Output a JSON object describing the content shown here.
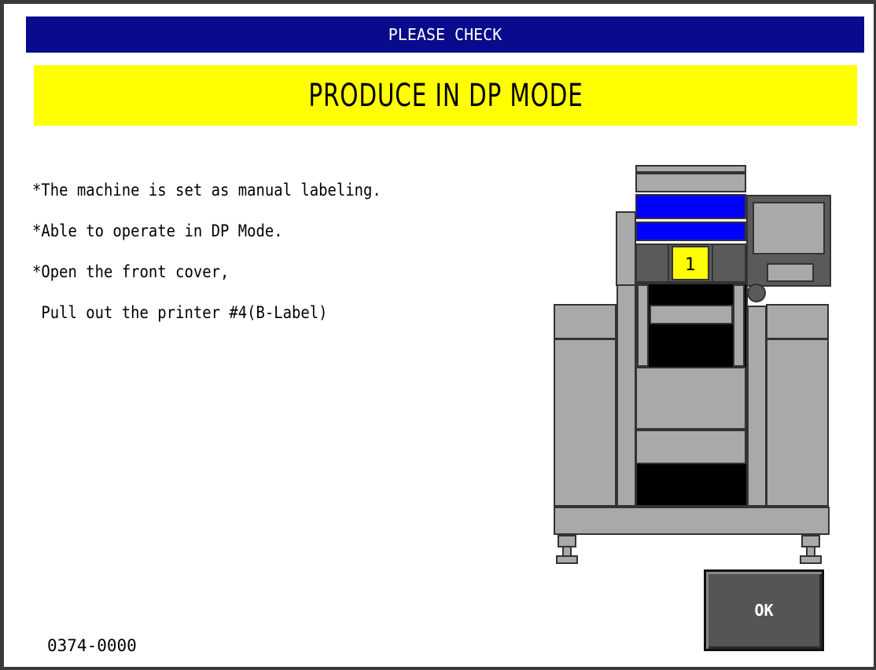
{
  "window": {
    "title": "PLEASE CHECK",
    "banner": "PRODUCE IN DP MODE"
  },
  "message": {
    "lines": [
      "*The machine is set as manual labeling.",
      "*Able to operate in DP Mode.",
      "*Open the front cover,",
      " Pull out the printer #4(B-Label)"
    ]
  },
  "machine": {
    "printer_number": "1"
  },
  "buttons": {
    "ok_label": "OK"
  },
  "status": {
    "code": "0374-0000"
  },
  "colors": {
    "title_bg": "#0a0a8c",
    "banner_bg": "#ffff00",
    "machine_gray": "#a9a9a9",
    "accent_blue": "#0000ff"
  }
}
